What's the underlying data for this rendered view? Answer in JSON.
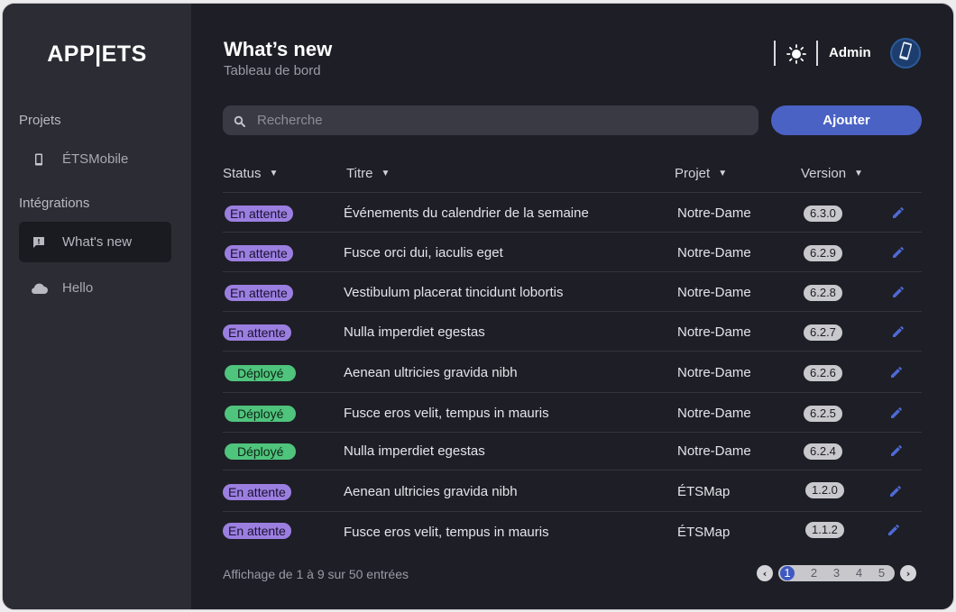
{
  "sidebar": {
    "logo": "APP|ETS",
    "sections": {
      "projects_label": "Projets",
      "integrations_label": "Intégrations"
    },
    "items": [
      {
        "label": "ÉTSMobile",
        "icon": "smartphone-icon"
      },
      {
        "label": "What's new",
        "icon": "feedback-icon",
        "active": true
      },
      {
        "label": "Hello",
        "icon": "cloud-icon"
      }
    ]
  },
  "header": {
    "title": "What’s new",
    "subtitle": "Tableau de bord",
    "user_name": "Admin",
    "theme_icon": "sun-icon",
    "avatar_icon": "phone-avatar-icon"
  },
  "toolbar": {
    "search_placeholder": "Recherche",
    "add_label": "Ajouter"
  },
  "table": {
    "columns": [
      "Status",
      "Titre",
      "Projet",
      "Version"
    ],
    "rows": [
      {
        "status": "En attente",
        "status_type": "pending",
        "title": "Événements du calendrier de la semaine",
        "project": "Notre-Dame",
        "version": "6.3.0"
      },
      {
        "status": "En attente",
        "status_type": "pending",
        "title": "Fusce orci dui, iaculis eget",
        "project": "Notre-Dame",
        "version": "6.2.9"
      },
      {
        "status": "En attente",
        "status_type": "pending",
        "title": "Vestibulum placerat tincidunt lobortis",
        "project": "Notre-Dame",
        "version": "6.2.8"
      },
      {
        "status": "En attente",
        "status_type": "pending",
        "title": "Nulla imperdiet egestas",
        "project": "Notre-Dame",
        "version": "6.2.7"
      },
      {
        "status": "Déployé",
        "status_type": "deployed",
        "title": "Aenean ultricies gravida nibh",
        "project": "Notre-Dame",
        "version": "6.2.6"
      },
      {
        "status": "Déployé",
        "status_type": "deployed",
        "title": "Fusce eros velit, tempus in mauris",
        "project": "Notre-Dame",
        "version": "6.2.5"
      },
      {
        "status": "Déployé",
        "status_type": "deployed",
        "title": "Nulla imperdiet egestas",
        "project": "Notre-Dame",
        "version": "6.2.4"
      },
      {
        "status": "En attente",
        "status_type": "pending",
        "title": "Aenean ultricies gravida nibh",
        "project": "ÉTSMap",
        "version": "1.2.0"
      },
      {
        "status": "En attente",
        "status_type": "pending",
        "title": "Fusce eros velit, tempus in mauris",
        "project": "ÉTSMap",
        "version": "1.1.2"
      }
    ]
  },
  "footer": {
    "info": "Affichage de 1 à 9 sur 50 entrées",
    "pages": [
      "1",
      "2",
      "3",
      "4",
      "5"
    ],
    "current_page": "1"
  },
  "colors": {
    "background": "#1e1e26",
    "sidebar": "#2c2c34",
    "accent": "#4a62c4",
    "pending": "#9b7fe0",
    "deployed": "#4fc47c",
    "version_badge": "#c8c8cd"
  }
}
